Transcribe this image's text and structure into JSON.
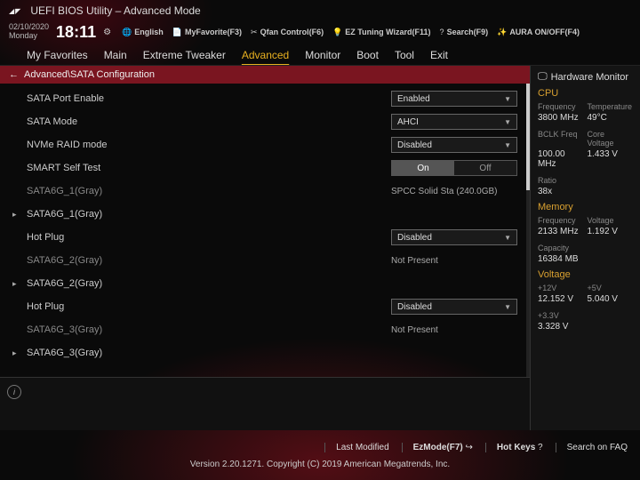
{
  "header": {
    "logo_text": "REPUBLIC OF GAMERS",
    "title": "UEFI BIOS Utility – Advanced Mode",
    "date": "02/10/2020",
    "day": "Monday",
    "time": "18:11",
    "toolbar": {
      "language": "English",
      "myfav": "MyFavorite(F3)",
      "qfan": "Qfan Control(F6)",
      "eztune": "EZ Tuning Wizard(F11)",
      "search": "Search(F9)",
      "aura": "AURA ON/OFF(F4)"
    }
  },
  "tabs": [
    "My Favorites",
    "Main",
    "Extreme Tweaker",
    "Advanced",
    "Monitor",
    "Boot",
    "Tool",
    "Exit"
  ],
  "active_tab": "Advanced",
  "breadcrumb": "Advanced\\SATA Configuration",
  "settings": {
    "sata_port_enable": {
      "label": "SATA Port Enable",
      "value": "Enabled"
    },
    "sata_mode": {
      "label": "SATA Mode",
      "value": "AHCI"
    },
    "nvme_raid": {
      "label": "NVMe RAID mode",
      "value": "Disabled"
    },
    "smart_self_test": {
      "label": "SMART Self Test",
      "on": "On",
      "off": "Off"
    },
    "sata6g_1_info": {
      "label": "SATA6G_1(Gray)",
      "value": "SPCC Solid Sta (240.0GB)"
    },
    "sata6g_1_header": "SATA6G_1(Gray)",
    "hotplug1": {
      "label": "Hot Plug",
      "value": "Disabled"
    },
    "sata6g_2_info": {
      "label": "SATA6G_2(Gray)",
      "value": "Not Present"
    },
    "sata6g_2_header": "SATA6G_2(Gray)",
    "hotplug2": {
      "label": "Hot Plug",
      "value": "Disabled"
    },
    "sata6g_3_info": {
      "label": "SATA6G_3(Gray)",
      "value": "Not Present"
    },
    "sata6g_3_header": "SATA6G_3(Gray)"
  },
  "hwmon": {
    "title": "Hardware Monitor",
    "cpu": {
      "title": "CPU",
      "freq_k": "Frequency",
      "freq_v": "3800 MHz",
      "temp_k": "Temperature",
      "temp_v": "49°C",
      "bclk_k": "BCLK Freq",
      "bclk_v": "100.00 MHz",
      "core_k": "Core Voltage",
      "core_v": "1.433 V",
      "ratio_k": "Ratio",
      "ratio_v": "38x"
    },
    "mem": {
      "title": "Memory",
      "freq_k": "Frequency",
      "freq_v": "2133 MHz",
      "volt_k": "Voltage",
      "volt_v": "1.192 V",
      "cap_k": "Capacity",
      "cap_v": "16384 MB"
    },
    "volt": {
      "title": "Voltage",
      "p12_k": "+12V",
      "p12_v": "12.152 V",
      "p5_k": "+5V",
      "p5_v": "5.040 V",
      "p33_k": "+3.3V",
      "p33_v": "3.328 V"
    }
  },
  "footer": {
    "last_modified": "Last Modified",
    "ezmode": "EzMode(F7)",
    "hotkeys": "Hot Keys",
    "searchfaq": "Search on FAQ",
    "copyright": "Version 2.20.1271. Copyright (C) 2019 American Megatrends, Inc."
  }
}
